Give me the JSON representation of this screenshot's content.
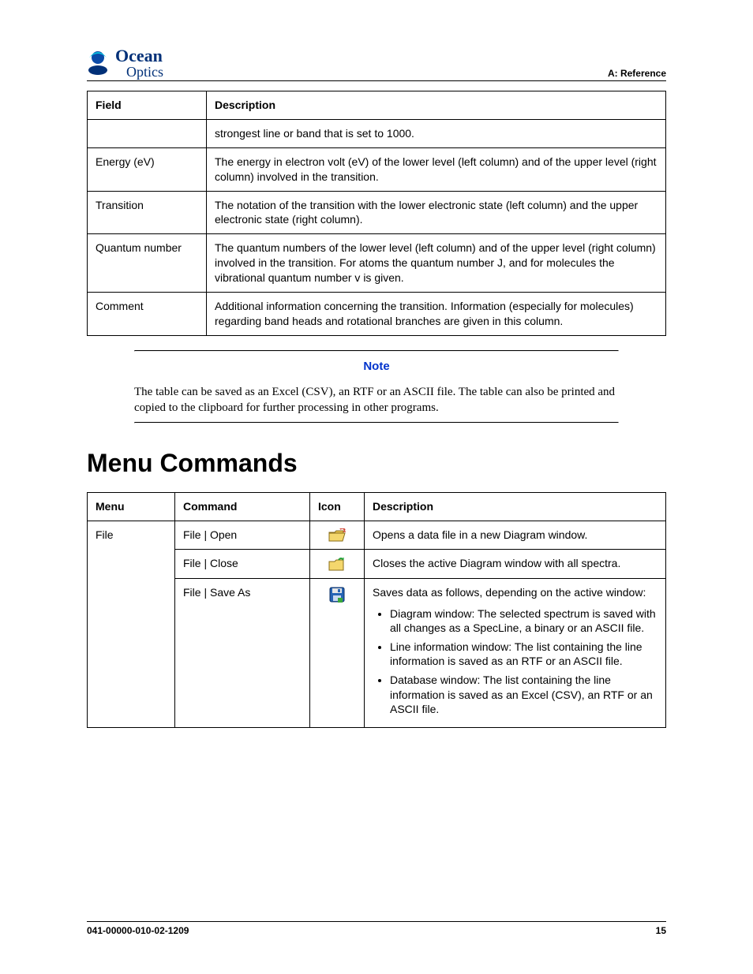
{
  "header": {
    "logo_top": "Ocean",
    "logo_bottom": "Optics",
    "ref_label": "A: Reference"
  },
  "fields_table": {
    "headers": [
      "Field",
      "Description"
    ],
    "rows": [
      {
        "field": "",
        "desc": "strongest line or band that is set to 1000."
      },
      {
        "field": "Energy (eV)",
        "desc": "The energy in electron volt (eV) of the lower level (left column) and of the upper level (right column) involved in the transition."
      },
      {
        "field": "Transition",
        "desc": "The notation of the transition with the lower electronic state (left column) and the upper electronic state (right column)."
      },
      {
        "field": "Quantum number",
        "desc": "The quantum numbers of the lower level (left column) and of the upper level (right column) involved in the transition. For atoms the quantum number J, and for molecules the vibrational quantum number v is given."
      },
      {
        "field": "Comment",
        "desc": "Additional information concerning the transition. Information (especially for molecules) regarding band heads and rotational branches are given in this column."
      }
    ]
  },
  "note": {
    "title": "Note",
    "body": "The table can be saved as an Excel (CSV), an RTF or an ASCII file. The table can also be printed and copied to the clipboard for further processing in other programs."
  },
  "section_heading": "Menu Commands",
  "menu_table": {
    "headers": [
      "Menu",
      "Command",
      "Icon",
      "Description"
    ],
    "rows": [
      {
        "menu": "File",
        "command": "File | Open",
        "icon": "open-folder-icon",
        "desc_intro": "Opens a data file in a new Diagram window.",
        "desc_list": []
      },
      {
        "menu": "",
        "command": "File | Close",
        "icon": "close-folder-icon",
        "desc_intro": "Closes the active Diagram window with all spectra.",
        "desc_list": []
      },
      {
        "menu": "",
        "command": "File | Save As",
        "icon": "save-disk-icon",
        "desc_intro": "Saves data as follows, depending on the active window:",
        "desc_list": [
          "Diagram window: The selected spectrum is saved with all changes as a SpecLine, a binary or an ASCII file.",
          "Line information window: The list containing the line information is saved as an RTF or an ASCII file.",
          "Database window: The list containing the line information is saved as an Excel (CSV), an RTF or an ASCII file."
        ]
      }
    ]
  },
  "footer": {
    "doc_number": "041-00000-010-02-1209",
    "page_number": "15"
  }
}
